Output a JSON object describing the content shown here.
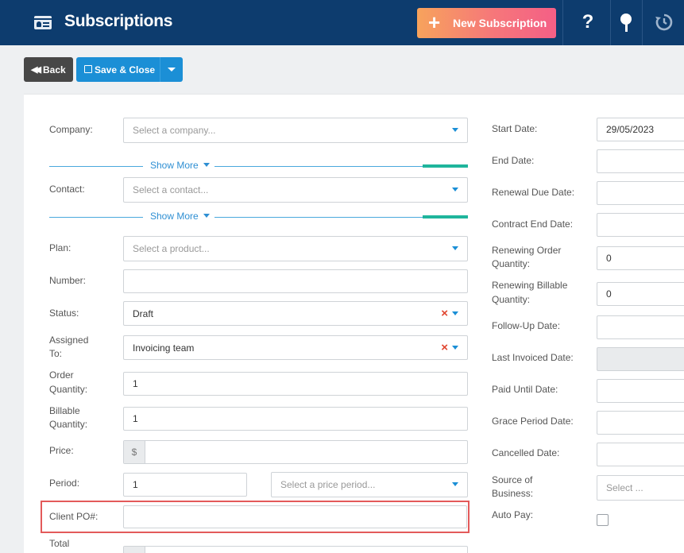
{
  "header": {
    "title": "Subscriptions",
    "new_button": "New Subscription",
    "help_icon": "question-mark-icon",
    "pin_icon": "pin-icon",
    "history_icon": "history-icon"
  },
  "toolbar": {
    "back_label": "Back",
    "save_close_label": "Save & Close"
  },
  "left_form": {
    "company_label": "Company:",
    "company_placeholder": "Select a company...",
    "show_more": "Show More",
    "contact_label": "Contact:",
    "contact_placeholder": "Select a contact...",
    "plan_label": "Plan:",
    "plan_placeholder": "Select a product...",
    "number_label": "Number:",
    "number_value": "",
    "status_label": "Status:",
    "status_value": "Draft",
    "assigned_label_1": "Assigned",
    "assigned_label_2": "To:",
    "assigned_value": "Invoicing team",
    "order_qty_label_1": "Order",
    "order_qty_label_2": "Quantity:",
    "order_qty_value": "1",
    "billable_qty_label_1": "Billable",
    "billable_qty_label_2": "Quantity:",
    "billable_qty_value": "1",
    "price_label": "Price:",
    "price_currency": "$",
    "price_value": "",
    "period_label": "Period:",
    "period_value": "1",
    "period_placeholder": "Select a price period...",
    "client_po_label": "Client PO#:",
    "client_po_value": "",
    "total_label": "Total"
  },
  "right_form": {
    "start_date_label": "Start Date:",
    "start_date_value": "29/05/2023",
    "end_date_label": "End Date:",
    "renewal_due_label": "Renewal Due Date:",
    "contract_end_label": "Contract End Date:",
    "renewing_order_label_1": "Renewing Order",
    "renewing_order_label_2": "Quantity:",
    "renewing_order_value": "0",
    "renewing_billable_label_1": "Renewing Billable",
    "renewing_billable_label_2": "Quantity:",
    "renewing_billable_value": "0",
    "follow_up_label": "Follow-Up Date:",
    "last_invoiced_label": "Last Invoiced Date:",
    "paid_until_label": "Paid Until Date:",
    "grace_period_label": "Grace Period Date:",
    "cancelled_label": "Cancelled Date:",
    "source_label_1": "Source of",
    "source_label_2": "Business:",
    "source_placeholder": "Select ...",
    "auto_pay_label": "Auto Pay:"
  },
  "colors": {
    "header_bg": "#0d3c6e",
    "accent_blue": "#1b8fd6",
    "teal": "#1fb59c",
    "highlight_red": "#e35a5a"
  }
}
